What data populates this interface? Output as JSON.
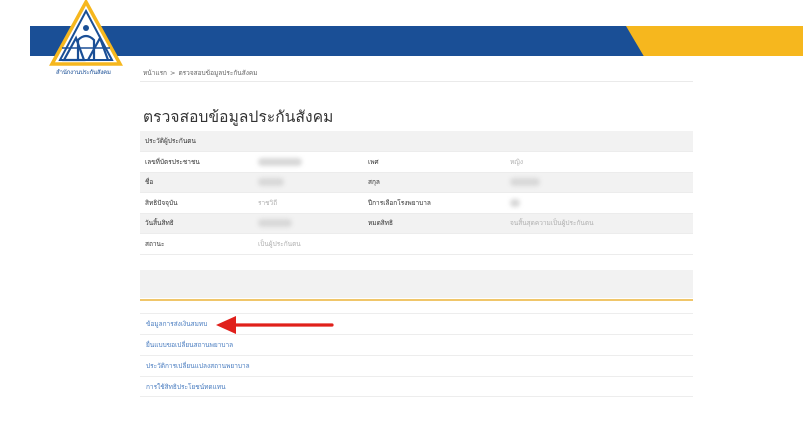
{
  "header": {
    "logo_caption": "สำนักงานประกันสังคม",
    "colors": {
      "blue": "#1a4f96",
      "yellow": "#f6b71e"
    }
  },
  "breadcrumb": {
    "home": "หน้าแรก",
    "separator": ">",
    "current": "ตรวจสอบข้อมูลประกันสังคม"
  },
  "page": {
    "title": "ตรวจสอบข้อมูลประกันสังคม"
  },
  "info_table": {
    "section_header": "ประวัติผู้ประกันตน",
    "rows": [
      {
        "label1": "เลขที่บัตรประชาชน",
        "value1": "",
        "label2": "เพศ",
        "value2": "หญิง"
      },
      {
        "label1": "ชื่อ",
        "value1": "",
        "label2": "สกุล",
        "value2": ""
      },
      {
        "label1": "สิทธิปัจจุบัน",
        "value1": "ราชวิถี",
        "label2": "ปีการเลือกโรงพยาบาล",
        "value2": ""
      },
      {
        "label1": "วันสิ้นสิทธิ",
        "value1": "",
        "label2": "หมดสิทธิ",
        "value2": "จนสิ้นสุดความเป็นผู้ประกันตน"
      },
      {
        "label1": "สถานะ",
        "value1": "เป็นผู้ประกันตน",
        "label2": "",
        "value2": ""
      }
    ]
  },
  "links": [
    {
      "label": "ข้อมูลการส่งเงินสมทบ"
    },
    {
      "label": "ยื่นแบบขอเปลี่ยนสถานพยาบาล"
    },
    {
      "label": "ประวัติการเปลี่ยนแปลงสถานพยาบาล"
    },
    {
      "label": "การใช้สิทธิประโยชน์ทดแทน"
    }
  ],
  "annotation": {
    "arrow_color": "#e0201b"
  }
}
